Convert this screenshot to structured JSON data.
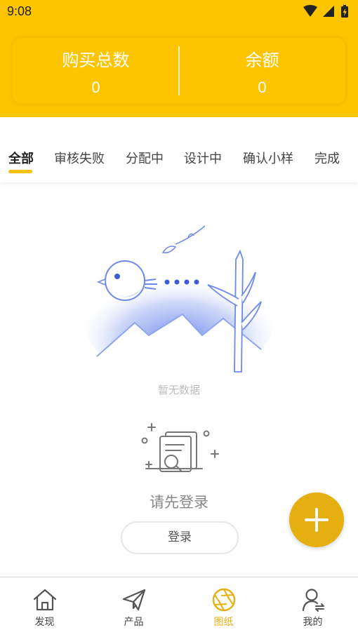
{
  "status_bar": {
    "time": "9:08",
    "icons": [
      "wifi-icon",
      "cellular-signal-icon",
      "battery-charging-icon"
    ]
  },
  "summary": {
    "purchase_total_label": "购买总数",
    "purchase_total_value": "0",
    "balance_label": "余额",
    "balance_value": "0"
  },
  "tabs": [
    {
      "label": "全部",
      "active": true
    },
    {
      "label": "审核失败",
      "active": false
    },
    {
      "label": "分配中",
      "active": false
    },
    {
      "label": "设计中",
      "active": false
    },
    {
      "label": "确认小样",
      "active": false
    },
    {
      "label": "完成",
      "active": false
    }
  ],
  "empty_state": {
    "text": "暂无数据",
    "illustration": "bird-mountain-empty-illustration"
  },
  "login": {
    "prompt": "请先登录",
    "button_label": "登录",
    "icon": "document-search-icon"
  },
  "fab": {
    "icon": "plus-icon"
  },
  "bottom_nav": [
    {
      "label": "发现",
      "icon": "home-icon",
      "active": false
    },
    {
      "label": "产品",
      "icon": "paper-plane-icon",
      "active": false
    },
    {
      "label": "图纸",
      "icon": "aperture-icon",
      "active": true
    },
    {
      "label": "我的",
      "icon": "user-icon",
      "active": false
    }
  ],
  "colors": {
    "brand_yellow": "#FDC500",
    "accent": "#E5AF10",
    "illustration_blue": "#5B7BE8"
  }
}
